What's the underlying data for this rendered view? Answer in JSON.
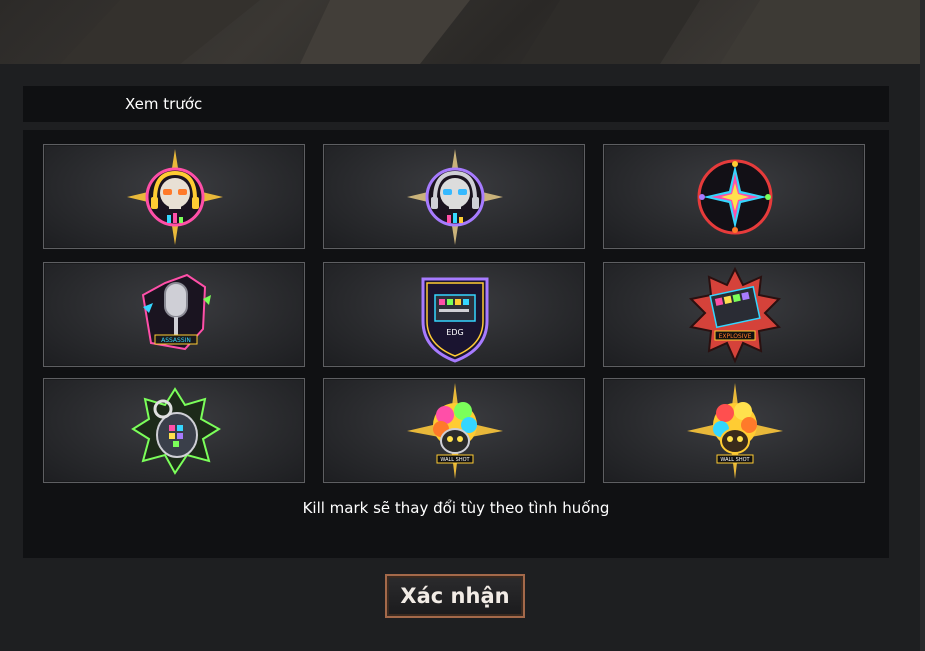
{
  "dialog": {
    "title": "Xem trước",
    "caption": "Kill mark sẽ thay đổi tùy theo tình huống",
    "confirm_label": "Xác nhận"
  },
  "kill_marks": [
    {
      "icon": "skull-dj-gold-icon"
    },
    {
      "icon": "skull-dj-silver-icon"
    },
    {
      "icon": "neon-star-compass-icon"
    },
    {
      "icon": "microphone-badge-icon",
      "label": "ASSASSIN"
    },
    {
      "icon": "dj-mixer-shield-icon",
      "label": "EDG"
    },
    {
      "icon": "explosive-mixer-icon",
      "label": "EXPLOSIVE"
    },
    {
      "icon": "neon-grenade-icon"
    },
    {
      "icon": "wall-shot-skull-icon",
      "label": "WALL SHOT"
    },
    {
      "icon": "wall-shot-skull-gold-icon",
      "label": "WALL SHOT"
    }
  ],
  "colors": {
    "dialog_bg": "#1e1f21",
    "panel_bg": "#101113",
    "button_border": "#a4694a"
  }
}
